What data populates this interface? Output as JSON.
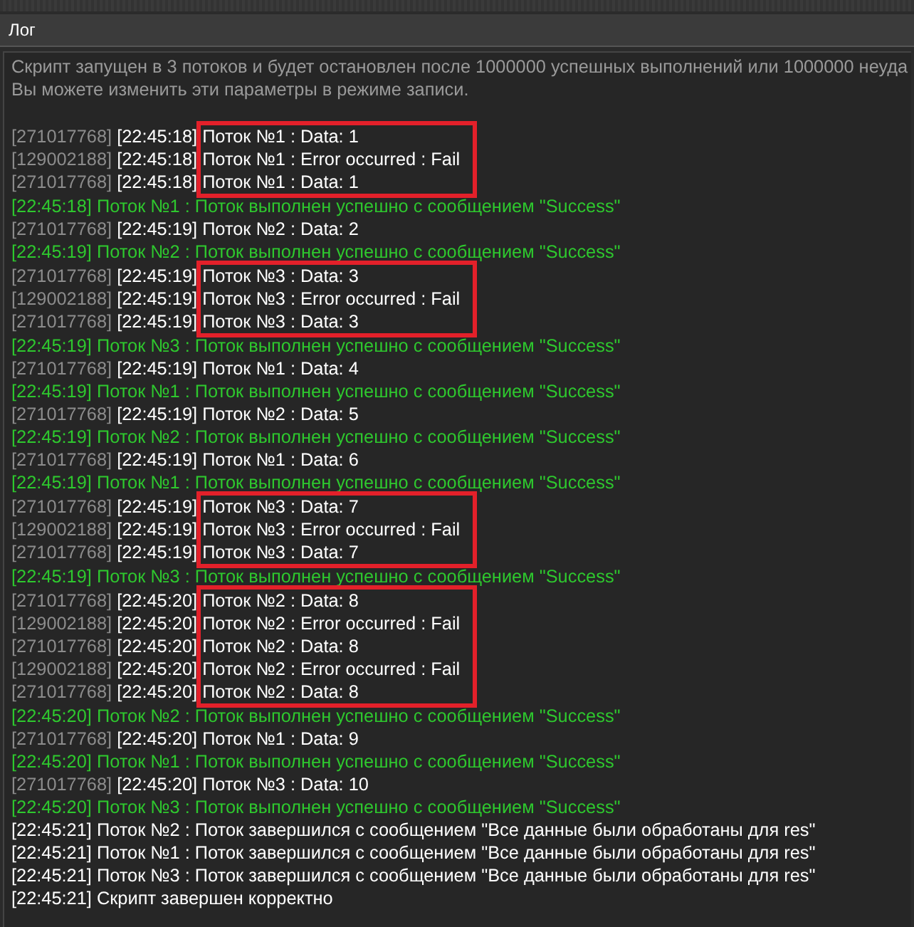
{
  "window": {
    "title": "Лог"
  },
  "intro": [
    "Скрипт запущен в 3 потоков и будет остановлен после 1000000 успешных выполнений или 1000000 неуда",
    "Вы можете изменить эти параметры в режиме записи."
  ],
  "lines": [
    {
      "kind": "data",
      "id": "[271017768]",
      "time": "[22:45:18]",
      "message": "Поток №1 : Data: 1",
      "highlighted": true
    },
    {
      "kind": "data",
      "id": "[129002188]",
      "time": "[22:45:18]",
      "message": "Поток №1 : Error occurred : Fail",
      "highlighted": true
    },
    {
      "kind": "data",
      "id": "[271017768]",
      "time": "[22:45:18]",
      "message": "Поток №1 : Data: 1",
      "highlighted": true
    },
    {
      "kind": "success",
      "time": "[22:45:18]",
      "message": "Поток №1 : Поток выполнен успешно с сообщением \"Success\"",
      "highlighted": false
    },
    {
      "kind": "data",
      "id": "[271017768]",
      "time": "[22:45:19]",
      "message": "Поток №2 : Data: 2",
      "highlighted": false
    },
    {
      "kind": "success",
      "time": "[22:45:19]",
      "message": "Поток №2 : Поток выполнен успешно с сообщением \"Success\"",
      "highlighted": false
    },
    {
      "kind": "data",
      "id": "[271017768]",
      "time": "[22:45:19]",
      "message": "Поток №3 : Data: 3",
      "highlighted": true
    },
    {
      "kind": "data",
      "id": "[129002188]",
      "time": "[22:45:19]",
      "message": "Поток №3 : Error occurred : Fail",
      "highlighted": true
    },
    {
      "kind": "data",
      "id": "[271017768]",
      "time": "[22:45:19]",
      "message": "Поток №3 : Data: 3",
      "highlighted": true
    },
    {
      "kind": "success",
      "time": "[22:45:19]",
      "message": "Поток №3 : Поток выполнен успешно с сообщением \"Success\"",
      "highlighted": false
    },
    {
      "kind": "data",
      "id": "[271017768]",
      "time": "[22:45:19]",
      "message": "Поток №1 : Data: 4",
      "highlighted": false
    },
    {
      "kind": "success",
      "time": "[22:45:19]",
      "message": "Поток №1 : Поток выполнен успешно с сообщением \"Success\"",
      "highlighted": false
    },
    {
      "kind": "data",
      "id": "[271017768]",
      "time": "[22:45:19]",
      "message": "Поток №2 : Data: 5",
      "highlighted": false
    },
    {
      "kind": "success",
      "time": "[22:45:19]",
      "message": "Поток №2 : Поток выполнен успешно с сообщением \"Success\"",
      "highlighted": false
    },
    {
      "kind": "data",
      "id": "[271017768]",
      "time": "[22:45:19]",
      "message": "Поток №1 : Data: 6",
      "highlighted": false
    },
    {
      "kind": "success",
      "time": "[22:45:19]",
      "message": "Поток №1 : Поток выполнен успешно с сообщением \"Success\"",
      "highlighted": false
    },
    {
      "kind": "data",
      "id": "[271017768]",
      "time": "[22:45:19]",
      "message": "Поток №3 : Data: 7",
      "highlighted": true
    },
    {
      "kind": "data",
      "id": "[129002188]",
      "time": "[22:45:19]",
      "message": "Поток №3 : Error occurred : Fail",
      "highlighted": true
    },
    {
      "kind": "data",
      "id": "[271017768]",
      "time": "[22:45:19]",
      "message": "Поток №3 : Data: 7",
      "highlighted": true
    },
    {
      "kind": "success",
      "time": "[22:45:19]",
      "message": "Поток №3 : Поток выполнен успешно с сообщением \"Success\"",
      "highlighted": false
    },
    {
      "kind": "data",
      "id": "[271017768]",
      "time": "[22:45:20]",
      "message": "Поток №2 : Data: 8",
      "highlighted": true
    },
    {
      "kind": "data",
      "id": "[129002188]",
      "time": "[22:45:20]",
      "message": "Поток №2 : Error occurred : Fail",
      "highlighted": true
    },
    {
      "kind": "data",
      "id": "[271017768]",
      "time": "[22:45:20]",
      "message": "Поток №2 : Data: 8",
      "highlighted": true
    },
    {
      "kind": "data",
      "id": "[129002188]",
      "time": "[22:45:20]",
      "message": "Поток №2 : Error occurred : Fail",
      "highlighted": true
    },
    {
      "kind": "data",
      "id": "[271017768]",
      "time": "[22:45:20]",
      "message": "Поток №2 : Data: 8",
      "highlighted": true
    },
    {
      "kind": "success",
      "time": "[22:45:20]",
      "message": "Поток №2 : Поток выполнен успешно с сообщением \"Success\"",
      "highlighted": false
    },
    {
      "kind": "data",
      "id": "[271017768]",
      "time": "[22:45:20]",
      "message": "Поток №1 : Data: 9",
      "highlighted": false
    },
    {
      "kind": "success",
      "time": "[22:45:20]",
      "message": "Поток №1 : Поток выполнен успешно с сообщением \"Success\"",
      "highlighted": false
    },
    {
      "kind": "data",
      "id": "[271017768]",
      "time": "[22:45:20]",
      "message": "Поток №3 : Data: 10",
      "highlighted": false
    },
    {
      "kind": "success",
      "time": "[22:45:20]",
      "message": "Поток №3 : Поток выполнен успешно с сообщением \"Success\"",
      "highlighted": false
    },
    {
      "kind": "info",
      "time": "[22:45:21]",
      "message": "Поток №2 : Поток завершился с сообщением \"Все данные были обработаны для res\"",
      "highlighted": false
    },
    {
      "kind": "info",
      "time": "[22:45:21]",
      "message": "Поток №1 : Поток завершился с сообщением \"Все данные были обработаны для res\"",
      "highlighted": false
    },
    {
      "kind": "info",
      "time": "[22:45:21]",
      "message": "Поток №3 : Поток завершился с сообщением \"Все данные были обработаны для res\"",
      "highlighted": false
    },
    {
      "kind": "info",
      "time": "[22:45:21]",
      "message": "Скрипт завершен корректно",
      "highlighted": false
    }
  ]
}
